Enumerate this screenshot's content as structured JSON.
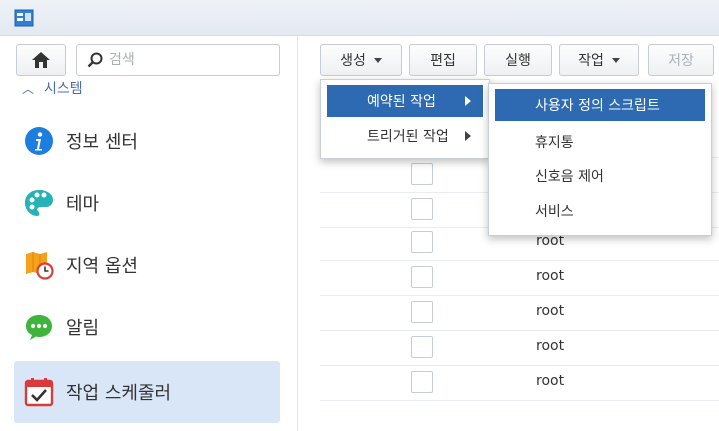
{
  "app": {
    "icon": "control-panel-icon"
  },
  "sidebar": {
    "search_placeholder": "검색",
    "section_label": "시스템",
    "items": [
      {
        "label": "정보 센터",
        "icon": "info-icon"
      },
      {
        "label": "테마",
        "icon": "palette-icon"
      },
      {
        "label": "지역 옵션",
        "icon": "regional-options-icon"
      },
      {
        "label": "알림",
        "icon": "notification-icon"
      },
      {
        "label": "작업 스케줄러",
        "icon": "task-scheduler-icon",
        "active": true
      }
    ]
  },
  "toolbar": {
    "create_label": "생성",
    "edit_label": "편집",
    "run_label": "실행",
    "action_label": "작업",
    "save_label": "저장"
  },
  "create_menu": {
    "items": [
      {
        "label": "예약된 작업",
        "selected": true
      },
      {
        "label": "트리거된 작업",
        "selected": false
      }
    ]
  },
  "submenu": {
    "items": [
      {
        "label": "사용자 정의 스크립트",
        "selected": true
      },
      {
        "label": "휴지통",
        "selected": false
      },
      {
        "label": "신호음 제어",
        "selected": false
      },
      {
        "label": "서비스",
        "selected": false
      }
    ]
  },
  "table": {
    "rows": [
      {
        "user": ""
      },
      {
        "user": ""
      },
      {
        "user": "root"
      },
      {
        "user": "root"
      },
      {
        "user": "root"
      },
      {
        "user": "root"
      },
      {
        "user": "root"
      },
      {
        "user": "root"
      }
    ]
  },
  "colors": {
    "accent": "#2d6ab1",
    "active_nav": "#d9e6f7",
    "section_header": "#4a6ea3"
  }
}
